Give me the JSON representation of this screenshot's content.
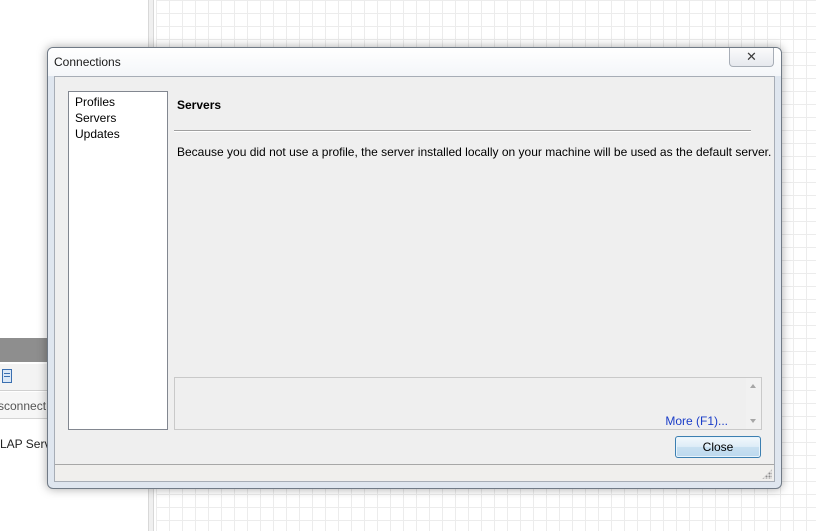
{
  "background": {
    "partial_text_1": "sconnect",
    "partial_text_2": "LAP Serve"
  },
  "dialog": {
    "title": "Connections",
    "close_glyph": "✕",
    "nav": {
      "items": [
        {
          "label": "Profiles"
        },
        {
          "label": "Servers"
        },
        {
          "label": "Updates"
        }
      ]
    },
    "page": {
      "heading": "Servers",
      "body": "Because you did not use a profile, the server installed locally on your machine will be used as the default server."
    },
    "help": {
      "more_link": "More (F1)..."
    },
    "buttons": {
      "close_label": "Close"
    }
  },
  "colors": {
    "link": "#1a3dc8",
    "button_border": "#3c7fb1",
    "window_frame": "#dfe6ef"
  }
}
